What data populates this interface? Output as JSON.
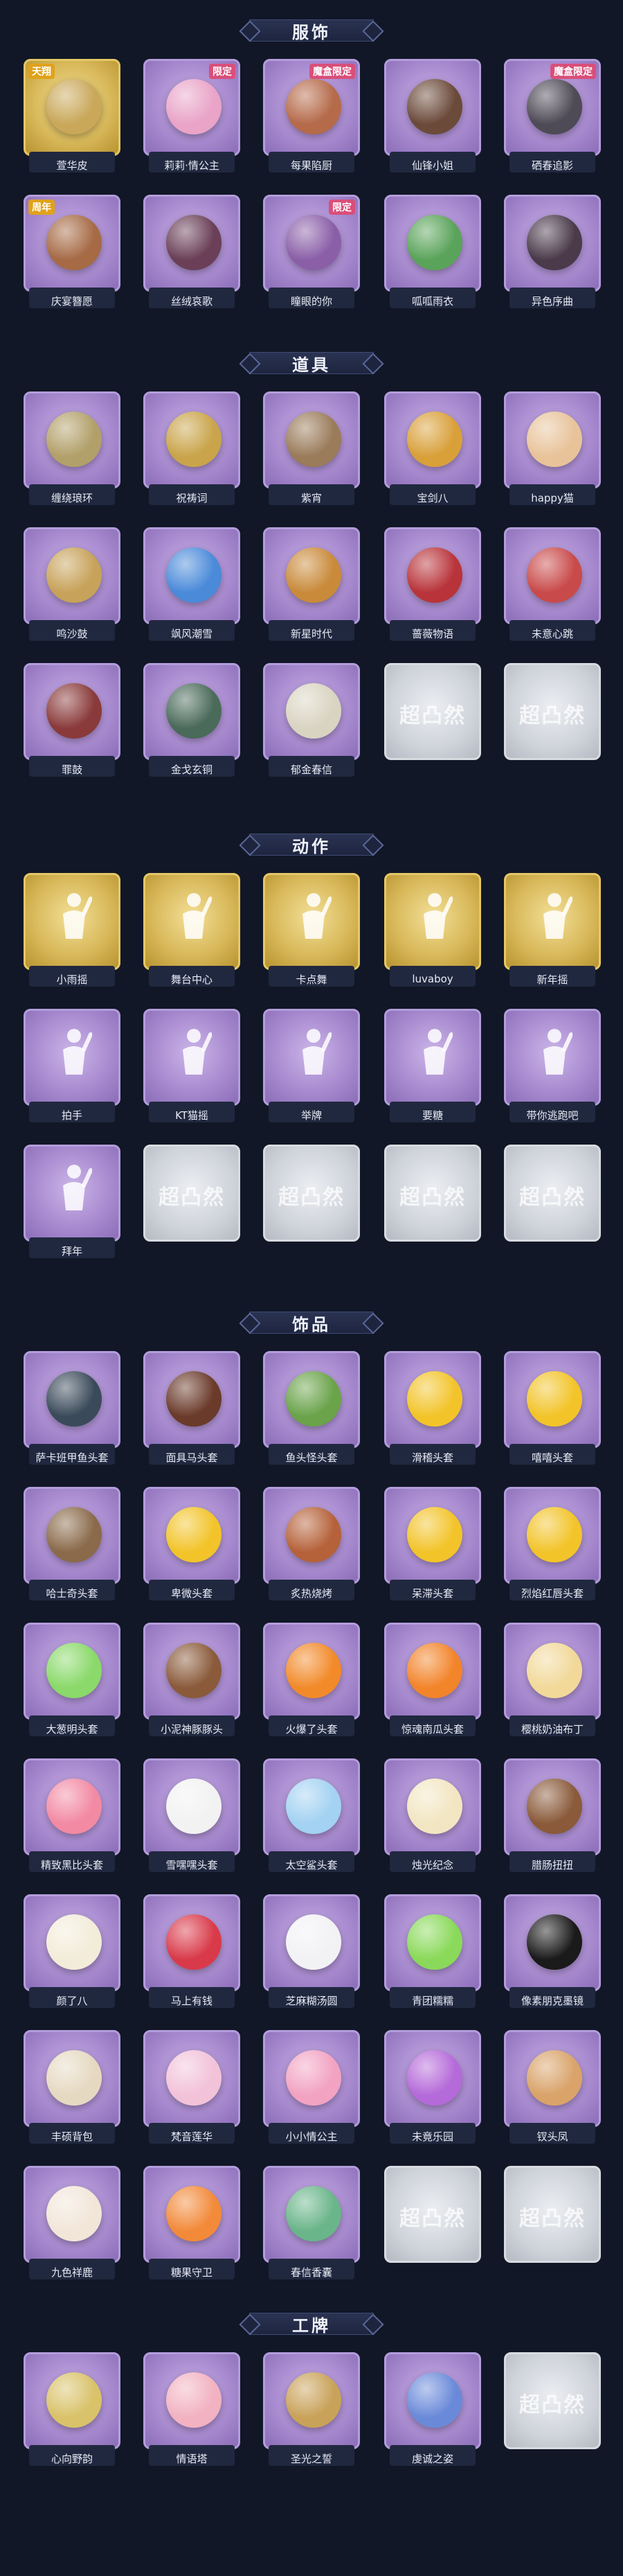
{
  "sections": [
    {
      "title": "服饰",
      "items": [
        {
          "label": "萱华皮",
          "card": "gold",
          "color": "#c9a85a",
          "tag": "",
          "tagTop": "天翔"
        },
        {
          "label": "莉莉·情公主",
          "card": "purple",
          "color": "#e9a4c8",
          "tag": "限定",
          "tagTop": ""
        },
        {
          "label": "每果陷厨",
          "card": "purple",
          "color": "#b56a4a",
          "tag": "魔盒限定",
          "tagTop": ""
        },
        {
          "label": "仙锋小姐",
          "card": "purple",
          "color": "#6b4a3a",
          "tag": "",
          "tagTop": ""
        },
        {
          "label": "硒春追影",
          "card": "purple",
          "color": "#4e4a56",
          "tag": "魔盒限定",
          "tagTop": ""
        },
        {
          "label": "庆宴簪愿",
          "card": "purple",
          "color": "#a66a45",
          "tag": "",
          "tagTop": "周年"
        },
        {
          "label": "丝绒哀歌",
          "card": "purple",
          "color": "#6a3f57",
          "tag": "",
          "tagTop": ""
        },
        {
          "label": "瞳眼的你",
          "card": "purple",
          "color": "#8a5fa8",
          "tag": "限定",
          "tagTop": ""
        },
        {
          "label": "呱呱雨衣",
          "card": "purple",
          "color": "#5aa35a",
          "tag": "",
          "tagTop": ""
        },
        {
          "label": "异色序曲",
          "card": "purple",
          "color": "#4a3a4a",
          "tag": "",
          "tagTop": ""
        }
      ]
    },
    {
      "title": "道具",
      "items": [
        {
          "label": "缠绕琅环",
          "card": "purple",
          "color": "#b2a06a",
          "tag": "",
          "tagTop": ""
        },
        {
          "label": "祝祷词",
          "card": "purple",
          "color": "#c9a44a",
          "tag": "",
          "tagTop": ""
        },
        {
          "label": "紫宵",
          "card": "purple",
          "color": "#9a7b5a",
          "tag": "",
          "tagTop": ""
        },
        {
          "label": "宝剑八",
          "card": "purple",
          "color": "#d9a03a",
          "tag": "",
          "tagTop": ""
        },
        {
          "label": "happy猫",
          "card": "purple",
          "color": "#e8c39a",
          "tag": "",
          "tagTop": ""
        },
        {
          "label": "鸣沙鼓",
          "card": "purple",
          "color": "#c7a25a",
          "tag": "",
          "tagTop": ""
        },
        {
          "label": "飒风潮雪",
          "card": "purple",
          "color": "#4a8ad9",
          "tag": "",
          "tagTop": ""
        },
        {
          "label": "新星时代",
          "card": "purple",
          "color": "#c98a3a",
          "tag": "",
          "tagTop": ""
        },
        {
          "label": "蔷薇物语",
          "card": "purple",
          "color": "#b8343a",
          "tag": "",
          "tagTop": ""
        },
        {
          "label": "未意心跳",
          "card": "purple",
          "color": "#c94a4a",
          "tag": "",
          "tagTop": ""
        },
        {
          "label": "罪鼓",
          "card": "purple",
          "color": "#8a3a3a",
          "tag": "",
          "tagTop": ""
        },
        {
          "label": "金戈玄铜",
          "card": "purple",
          "color": "#4a6a5a",
          "tag": "",
          "tagTop": ""
        },
        {
          "label": "郁金春信",
          "card": "purple",
          "color": "#d9d4c2",
          "tag": "",
          "tagTop": ""
        },
        {
          "label": "",
          "card": "grey",
          "color": "",
          "tag": "",
          "tagTop": "",
          "wm": "超凸然"
        },
        {
          "label": "",
          "card": "grey",
          "color": "",
          "tag": "",
          "tagTop": "",
          "wm": "超凸然"
        }
      ]
    },
    {
      "title": "动作",
      "items": [
        {
          "label": "小雨摇",
          "card": "gold",
          "pose": true
        },
        {
          "label": "舞台中心",
          "card": "gold",
          "pose": true
        },
        {
          "label": "卡点舞",
          "card": "gold",
          "pose": true
        },
        {
          "label": "luvaboy",
          "card": "gold",
          "pose": true
        },
        {
          "label": "新年摇",
          "card": "gold",
          "pose": true
        },
        {
          "label": "拍手",
          "card": "purple",
          "pose": true
        },
        {
          "label": "KT猫摇",
          "card": "purple",
          "pose": true
        },
        {
          "label": "举牌",
          "card": "purple",
          "pose": true
        },
        {
          "label": "要糖",
          "card": "purple",
          "pose": true
        },
        {
          "label": "带你逃跑吧",
          "card": "purple",
          "pose": true
        },
        {
          "label": "拜年",
          "card": "purple",
          "pose": true
        },
        {
          "label": "",
          "card": "grey",
          "wm": "超凸然"
        },
        {
          "label": "",
          "card": "grey",
          "wm": "超凸然"
        },
        {
          "label": "",
          "card": "grey",
          "wm": "超凸然"
        },
        {
          "label": "",
          "card": "grey",
          "wm": "超凸然"
        }
      ]
    },
    {
      "title": "饰品",
      "items": [
        {
          "label": "萨卡班甲鱼头套",
          "card": "purple",
          "color": "#3a4a5a"
        },
        {
          "label": "面具马头套",
          "card": "purple",
          "color": "#6a3a2a"
        },
        {
          "label": "鱼头怪头套",
          "card": "purple",
          "color": "#6aa34a"
        },
        {
          "label": "滑稽头套",
          "card": "purple",
          "color": "#f2c42a"
        },
        {
          "label": "嘻嘻头套",
          "card": "purple",
          "color": "#f2c42a"
        },
        {
          "label": "哈士奇头套",
          "card": "purple",
          "color": "#8a6a4a"
        },
        {
          "label": "卑微头套",
          "card": "purple",
          "color": "#f2c42a"
        },
        {
          "label": "炙热烧烤",
          "card": "purple",
          "color": "#b5623a"
        },
        {
          "label": "呆滞头套",
          "card": "purple",
          "color": "#f2c42a"
        },
        {
          "label": "烈焰红唇头套",
          "card": "purple",
          "color": "#f2c42a"
        },
        {
          "label": "大葱明头套",
          "card": "purple",
          "color": "#8ad96a"
        },
        {
          "label": "小泥神豚豚头",
          "card": "purple",
          "color": "#8a5a3a"
        },
        {
          "label": "火爆了头套",
          "card": "purple",
          "color": "#f28a2a"
        },
        {
          "label": "惊魂南瓜头套",
          "card": "purple",
          "color": "#f2842a"
        },
        {
          "label": "樱桃奶油布丁",
          "card": "purple",
          "color": "#f2d99a"
        },
        {
          "label": "精致黑比头套",
          "card": "purple",
          "color": "#f28aa3"
        },
        {
          "label": "雪嘿嘿头套",
          "card": "purple",
          "color": "#f2f2f2"
        },
        {
          "label": "太空鲨头套",
          "card": "purple",
          "color": "#a3d2f2"
        },
        {
          "label": "烛光纪念",
          "card": "purple",
          "color": "#f2e6c2"
        },
        {
          "label": "腊肠扭扭",
          "card": "purple",
          "color": "#8a5a3a"
        },
        {
          "label": "颜了八",
          "card": "purple",
          "color": "#f2ecd9"
        },
        {
          "label": "马上有钱",
          "card": "purple",
          "color": "#d93a4a"
        },
        {
          "label": "芝麻糊汤圆",
          "card": "purple",
          "color": "#f2f2f5"
        },
        {
          "label": "青团糯糯",
          "card": "purple",
          "color": "#8ad95a"
        },
        {
          "label": "像素朋克墨镜",
          "card": "purple",
          "color": "#1a1a1a"
        },
        {
          "label": "丰硕背包",
          "card": "purple",
          "color": "#e6d9c2"
        },
        {
          "label": "梵音莲华",
          "card": "purple",
          "color": "#f2c2d9"
        },
        {
          "label": "小小情公主",
          "card": "purple",
          "color": "#f2a3c2"
        },
        {
          "label": "未竟乐园",
          "card": "purple",
          "color": "#b56ad9"
        },
        {
          "label": "钗头凤",
          "card": "purple",
          "color": "#d9a36a"
        },
        {
          "label": "九色祥鹿",
          "card": "purple",
          "color": "#f2e6d9"
        },
        {
          "label": "糖果守卫",
          "card": "purple",
          "color": "#f28a3a"
        },
        {
          "label": "春信香囊",
          "card": "purple",
          "color": "#6ab58a"
        },
        {
          "label": "",
          "card": "grey",
          "wm": "超凸然"
        },
        {
          "label": "",
          "card": "grey",
          "wm": "超凸然"
        }
      ]
    },
    {
      "title": "工牌",
      "items": [
        {
          "label": "心向野韵",
          "card": "purple",
          "color": "#d9c26a"
        },
        {
          "label": "情语塔",
          "card": "purple",
          "color": "#f2b2c2"
        },
        {
          "label": "圣光之誓",
          "card": "purple",
          "color": "#c9a25a"
        },
        {
          "label": "虔诚之姿",
          "card": "purple",
          "color": "#6a8ad9"
        },
        {
          "label": "",
          "card": "grey",
          "wm": "超凸然"
        }
      ]
    }
  ]
}
